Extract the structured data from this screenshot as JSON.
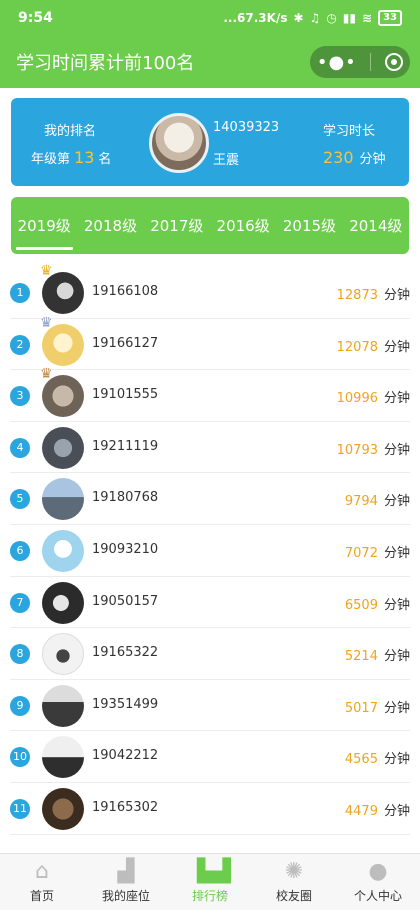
{
  "status_bar": {
    "time": "9:54",
    "network_speed": "...67.3K/s",
    "battery": "33"
  },
  "header": {
    "title": "学习时间累计前100名"
  },
  "profile": {
    "rank_label": "我的排名",
    "grade_prefix": "年级第",
    "rank_number": "13",
    "rank_suffix": "名",
    "student_id": "14039323",
    "name": "王震",
    "study_time_label": "学习时长",
    "study_minutes": "230",
    "minutes_unit": "分钟"
  },
  "grade_tabs": [
    "2019级",
    "2018级",
    "2017级",
    "2016级",
    "2015级",
    "2014级"
  ],
  "active_tab": "2019级",
  "ranking": [
    {
      "rank": "1",
      "id": "19166108",
      "minutes": "12873",
      "unit": "分钟",
      "crown": true
    },
    {
      "rank": "2",
      "id": "19166127",
      "minutes": "12078",
      "unit": "分钟",
      "crown": true
    },
    {
      "rank": "3",
      "id": "19101555",
      "minutes": "10996",
      "unit": "分钟",
      "crown": true
    },
    {
      "rank": "4",
      "id": "19211119",
      "minutes": "10793",
      "unit": "分钟",
      "crown": false
    },
    {
      "rank": "5",
      "id": "19180768",
      "minutes": "9794",
      "unit": "分钟",
      "crown": false
    },
    {
      "rank": "6",
      "id": "19093210",
      "minutes": "7072",
      "unit": "分钟",
      "crown": false
    },
    {
      "rank": "7",
      "id": "19050157",
      "minutes": "6509",
      "unit": "分钟",
      "crown": false
    },
    {
      "rank": "8",
      "id": "19165322",
      "minutes": "5214",
      "unit": "分钟",
      "crown": false
    },
    {
      "rank": "9",
      "id": "19351499",
      "minutes": "5017",
      "unit": "分钟",
      "crown": false
    },
    {
      "rank": "10",
      "id": "19042212",
      "minutes": "4565",
      "unit": "分钟",
      "crown": false
    },
    {
      "rank": "11",
      "id": "19165302",
      "minutes": "4479",
      "unit": "分钟",
      "crown": false
    }
  ],
  "bottom_nav": [
    {
      "label": "首页",
      "icon": "home-icon"
    },
    {
      "label": "我的座位",
      "icon": "sofa-icon"
    },
    {
      "label": "排行榜",
      "icon": "podium-icon",
      "active": true
    },
    {
      "label": "校友圈",
      "icon": "camera-aperture-icon"
    },
    {
      "label": "个人中心",
      "icon": "user-icon"
    }
  ],
  "colors": {
    "brand_green": "#6ccc4c",
    "card_blue": "#2ba5de",
    "highlight_orange": "#f0a31c"
  }
}
